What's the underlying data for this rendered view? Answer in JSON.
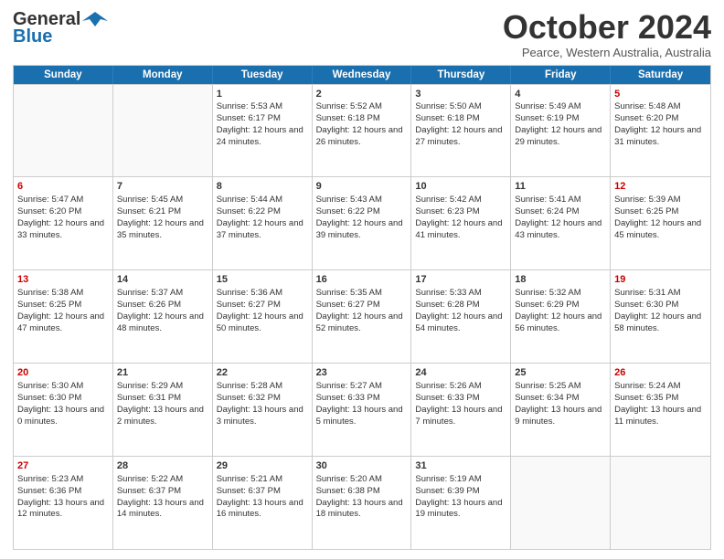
{
  "header": {
    "logo_line1": "General",
    "logo_line2": "Blue",
    "month": "October 2024",
    "location": "Pearce, Western Australia, Australia"
  },
  "days": [
    "Sunday",
    "Monday",
    "Tuesday",
    "Wednesday",
    "Thursday",
    "Friday",
    "Saturday"
  ],
  "weeks": [
    [
      {
        "day": "",
        "info": ""
      },
      {
        "day": "",
        "info": ""
      },
      {
        "day": "1",
        "info": "Sunrise: 5:53 AM\nSunset: 6:17 PM\nDaylight: 12 hours and 24 minutes."
      },
      {
        "day": "2",
        "info": "Sunrise: 5:52 AM\nSunset: 6:18 PM\nDaylight: 12 hours and 26 minutes."
      },
      {
        "day": "3",
        "info": "Sunrise: 5:50 AM\nSunset: 6:18 PM\nDaylight: 12 hours and 27 minutes."
      },
      {
        "day": "4",
        "info": "Sunrise: 5:49 AM\nSunset: 6:19 PM\nDaylight: 12 hours and 29 minutes."
      },
      {
        "day": "5",
        "info": "Sunrise: 5:48 AM\nSunset: 6:20 PM\nDaylight: 12 hours and 31 minutes."
      }
    ],
    [
      {
        "day": "6",
        "info": "Sunrise: 5:47 AM\nSunset: 6:20 PM\nDaylight: 12 hours and 33 minutes."
      },
      {
        "day": "7",
        "info": "Sunrise: 5:45 AM\nSunset: 6:21 PM\nDaylight: 12 hours and 35 minutes."
      },
      {
        "day": "8",
        "info": "Sunrise: 5:44 AM\nSunset: 6:22 PM\nDaylight: 12 hours and 37 minutes."
      },
      {
        "day": "9",
        "info": "Sunrise: 5:43 AM\nSunset: 6:22 PM\nDaylight: 12 hours and 39 minutes."
      },
      {
        "day": "10",
        "info": "Sunrise: 5:42 AM\nSunset: 6:23 PM\nDaylight: 12 hours and 41 minutes."
      },
      {
        "day": "11",
        "info": "Sunrise: 5:41 AM\nSunset: 6:24 PM\nDaylight: 12 hours and 43 minutes."
      },
      {
        "day": "12",
        "info": "Sunrise: 5:39 AM\nSunset: 6:25 PM\nDaylight: 12 hours and 45 minutes."
      }
    ],
    [
      {
        "day": "13",
        "info": "Sunrise: 5:38 AM\nSunset: 6:25 PM\nDaylight: 12 hours and 47 minutes."
      },
      {
        "day": "14",
        "info": "Sunrise: 5:37 AM\nSunset: 6:26 PM\nDaylight: 12 hours and 48 minutes."
      },
      {
        "day": "15",
        "info": "Sunrise: 5:36 AM\nSunset: 6:27 PM\nDaylight: 12 hours and 50 minutes."
      },
      {
        "day": "16",
        "info": "Sunrise: 5:35 AM\nSunset: 6:27 PM\nDaylight: 12 hours and 52 minutes."
      },
      {
        "day": "17",
        "info": "Sunrise: 5:33 AM\nSunset: 6:28 PM\nDaylight: 12 hours and 54 minutes."
      },
      {
        "day": "18",
        "info": "Sunrise: 5:32 AM\nSunset: 6:29 PM\nDaylight: 12 hours and 56 minutes."
      },
      {
        "day": "19",
        "info": "Sunrise: 5:31 AM\nSunset: 6:30 PM\nDaylight: 12 hours and 58 minutes."
      }
    ],
    [
      {
        "day": "20",
        "info": "Sunrise: 5:30 AM\nSunset: 6:30 PM\nDaylight: 13 hours and 0 minutes."
      },
      {
        "day": "21",
        "info": "Sunrise: 5:29 AM\nSunset: 6:31 PM\nDaylight: 13 hours and 2 minutes."
      },
      {
        "day": "22",
        "info": "Sunrise: 5:28 AM\nSunset: 6:32 PM\nDaylight: 13 hours and 3 minutes."
      },
      {
        "day": "23",
        "info": "Sunrise: 5:27 AM\nSunset: 6:33 PM\nDaylight: 13 hours and 5 minutes."
      },
      {
        "day": "24",
        "info": "Sunrise: 5:26 AM\nSunset: 6:33 PM\nDaylight: 13 hours and 7 minutes."
      },
      {
        "day": "25",
        "info": "Sunrise: 5:25 AM\nSunset: 6:34 PM\nDaylight: 13 hours and 9 minutes."
      },
      {
        "day": "26",
        "info": "Sunrise: 5:24 AM\nSunset: 6:35 PM\nDaylight: 13 hours and 11 minutes."
      }
    ],
    [
      {
        "day": "27",
        "info": "Sunrise: 5:23 AM\nSunset: 6:36 PM\nDaylight: 13 hours and 12 minutes."
      },
      {
        "day": "28",
        "info": "Sunrise: 5:22 AM\nSunset: 6:37 PM\nDaylight: 13 hours and 14 minutes."
      },
      {
        "day": "29",
        "info": "Sunrise: 5:21 AM\nSunset: 6:37 PM\nDaylight: 13 hours and 16 minutes."
      },
      {
        "day": "30",
        "info": "Sunrise: 5:20 AM\nSunset: 6:38 PM\nDaylight: 13 hours and 18 minutes."
      },
      {
        "day": "31",
        "info": "Sunrise: 5:19 AM\nSunset: 6:39 PM\nDaylight: 13 hours and 19 minutes."
      },
      {
        "day": "",
        "info": ""
      },
      {
        "day": "",
        "info": ""
      }
    ]
  ]
}
